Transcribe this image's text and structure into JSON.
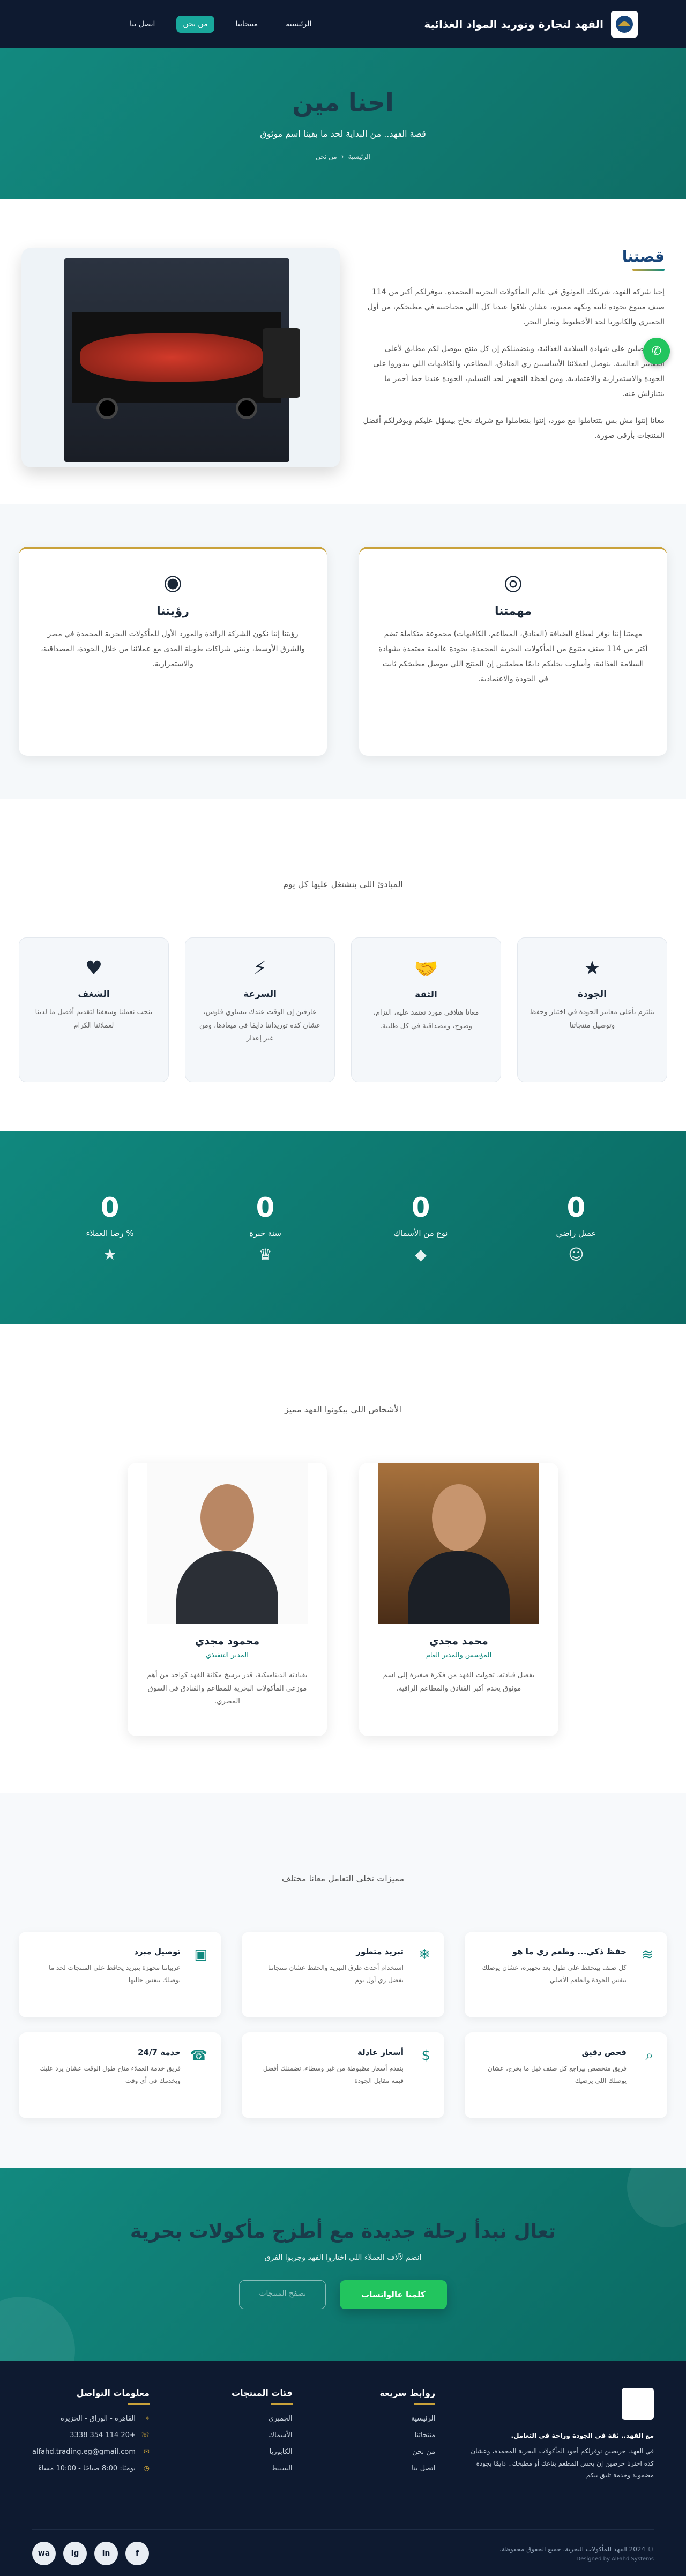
{
  "nav": {
    "brand": "الفهد لتجارة وتوريد المواد الغذائية",
    "links": [
      "الرئيسية",
      "منتجاتنا",
      "من نحن",
      "اتصل بنا"
    ]
  },
  "hero": {
    "title": "احنا مين",
    "subtitle": "قصة الفهد.. من البداية لحد ما بقينا اسم موثوق",
    "breadcrumb": [
      "الرئيسية",
      "من نحن"
    ]
  },
  "story": {
    "title": "قصتنا",
    "paragraphs": [
      "إحنا شركة الفهد، شريكك الموثوق في عالم المأكولات البحرية المجمدة. بنوفرلكم أكتر من 114 صنف متنوع بجودة ثابتة ونكهة مميزة، عشان تلاقوا عندنا كل اللي محتاجينه في مطبخكم، من أول الجمبري والكابوريا لحد الأخطبوط وثمار البحر.",
      "إحنا حاصلين على شهادة السلامة الغذائية، وبنضمنلكم إن كل منتج بيوصل لكم مطابق لأعلى المعايير العالمية. بنوصل لعملائنا الأساسيين زي الفنادق، المطاعم، والكافيهات اللي بيدوروا على الجودة والاستمرارية والاعتمادية. ومن لحظة التجهيز لحد التسليم، الجودة عندنا خط أحمر ما بنتنازلش عنه.",
      "معانا إنتوا مش بس بتتعاملوا مع مورد، إنتوا بتتعاملوا مع شريك نجاح بيسهّل عليكم ويوفرلكم أفضل المنتجات بأرقى صورة."
    ]
  },
  "vision": {
    "title": "رؤيتنا",
    "text": "رؤيتنا إننا نكون الشركة الرائدة والمورد الأول للمأكولات البحرية المجمدة في مصر والشرق الأوسط، ونبني شراكات طويلة المدى مع عملائنا من خلال الجودة، المصداقية، والاستمرارية."
  },
  "mission": {
    "title": "مهمتنا",
    "text": "مهمتنا إننا نوفر لقطاع الضيافة (الفنادق، المطاعم، الكافيهات) مجموعة متكاملة تضم أكتر من 114 صنف متنوع من المأكولات البحرية المجمدة، بجودة عالمية معتمدة بشهادة السلامة الغذائية، وأسلوب يخليكم دايمًا مطمئنين إن المنتج اللي بيوصل مطبخكم ثابت في الجودة والاعتمادية."
  },
  "values": {
    "heading": "المبادئ اللي بنشتغل عليها كل يوم",
    "items": [
      {
        "icon": "star",
        "title": "الجودة",
        "text": "بنلتزم بأعلى معايير الجودة في اختيار وحفظ وتوصيل منتجاتنا"
      },
      {
        "icon": "handshake",
        "title": "الثقة",
        "text": "معانا هتلاقي مورد تعتمد عليه، التزام، وضوح، ومصداقية في كل طلبية."
      },
      {
        "icon": "bolt",
        "title": "السرعة",
        "text": "عارفين إن الوقت عندك بيساوي فلوس، عشان كده توريداتنا دايمًا في ميعادها، ومن غير إعذار"
      },
      {
        "icon": "heart",
        "title": "الشغف",
        "text": "بنحب نعملنا وشغفنا لتقديم أفضل ما لدينا لعملائنا الكرام"
      }
    ]
  },
  "stats": [
    {
      "value": "0",
      "label": "عميل راضي",
      "icon": "smile"
    },
    {
      "value": "0",
      "label": "نوع من الأسماك",
      "icon": "fish"
    },
    {
      "value": "0",
      "label": "سنة خبرة",
      "icon": "trophy"
    },
    {
      "value": "0",
      "label": "% رضا العملاء",
      "icon": "star"
    }
  ],
  "team": {
    "heading": "الأشخاص اللي بيكونوا الفهد مميز",
    "members": [
      {
        "name": "محمد مجدي",
        "role": "المؤسس والمدير العام",
        "text": "بفضل قيادته، تحولت الفهد من فكرة صغيرة إلى اسم موثوق يخدم أكبر الفنادق والمطاعم الراقية."
      },
      {
        "name": "محمود مجدي",
        "role": "المدير التنفيذي",
        "text": "بقيادته الديناميكية، قدر يرسخ مكانة الفهد كواحد من أهم موزعي المأكولات البحرية للمطاعم والفنادق في السوق المصري."
      }
    ]
  },
  "features": {
    "heading": "مميزات تخلي التعامل معانا مختلف",
    "items": [
      {
        "icon": "waves",
        "title": "حفظ ذكي... وطعم زي ما هو",
        "text": "كل صنف بيتحفظ على طول بعد تجهيزه، عشان يوصلك بنفس الجودة والطعم الأصلي"
      },
      {
        "icon": "snowflake",
        "title": "تبريد متطور",
        "text": "استخدام أحدث طرق التبريد والحفظ عشان منتجاتنا تفضل زي أول يوم"
      },
      {
        "icon": "truck",
        "title": "توصيل مبرد",
        "text": "عربياتنا مجهزة بتبريد يحافظ على المنتجات لحد ما توصلك بنفس حالتها"
      },
      {
        "icon": "search",
        "title": "فحص دقيق",
        "text": "فريق متخصص بيراجع كل صنف قبل ما يخرج، عشان يوصلك اللي يرضيك"
      },
      {
        "icon": "dollar",
        "title": "أسعار عادلة",
        "text": "بنقدم أسعار مظبوطة من غير وسطاء، تضمنلك أفضل قيمة مقابل الجودة"
      },
      {
        "icon": "headset",
        "title": "خدمة 24/7",
        "text": "فريق خدمة العملاء متاح طول الوقت عشان يرد عليك ويخدمك في أي وقت"
      }
    ]
  },
  "cta": {
    "title": "تعال نبدأ رحلة جديدة مع أطزج مأكولات بحرية",
    "text": "انضم لآلاف العملاء اللي اختاروا الفهد وجربوا الفرق",
    "primary": "كلمنا عالواتساب",
    "secondary": "تصفح المنتجات"
  },
  "footer": {
    "about": "مع الفهد.. ثقة في الجودة وراحة في التعامل.",
    "about_text": "في الفهد، حريصين نوفرلكم أجود المأكولات البحرية المجمدة، وعشان كده اخترنا حرصين إن يحس المطعم بتاعك أو مطبخك.. دايمًا بجودة مضمونة وخدمة تليق بيكم",
    "quick_title": "روابط سريعة",
    "quick": [
      "الرئيسية",
      "منتجاتنا",
      "من نحن",
      "اتصل بنا"
    ],
    "cats_title": "فئات المنتجات",
    "cats": [
      "الجمبري",
      "الأسماك",
      "الكابوريا",
      "السبيط"
    ],
    "contact_title": "معلومات التواصل",
    "contact": [
      "القاهرة - الوراق - الجزيرة",
      "+20 114 354 3338",
      "alfahd.trading.eg@gmail.com",
      "يوميًا: 8:00 صباحًا - 10:00 مساءً"
    ],
    "copyright": "© 2024 الفهد للمأكولات البحرية. جميع الحقوق محفوظة.",
    "credit": "Designed by AlFahd Systems",
    "social": [
      "f",
      "in",
      "ig",
      "wa"
    ]
  },
  "colors": {
    "primary": "#10887e",
    "dark": "#0e1a30",
    "accent": "#c9a23a",
    "whatsapp": "#22c55e"
  }
}
